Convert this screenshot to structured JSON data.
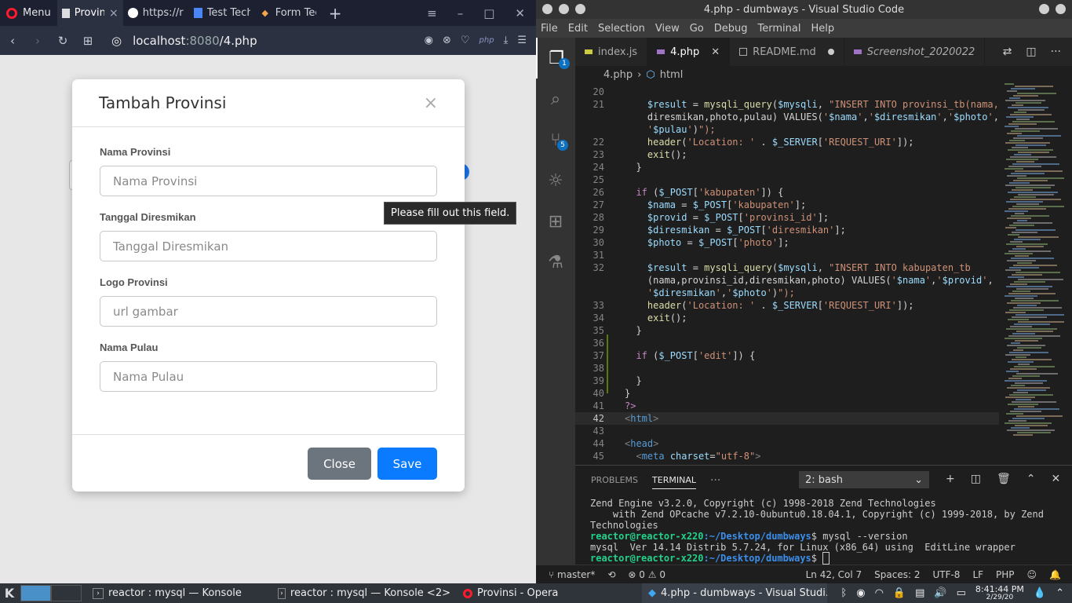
{
  "browser": {
    "menu_label": "Menu",
    "tabs": [
      {
        "label": "Provinsi",
        "active": true
      },
      {
        "label": "https://r"
      },
      {
        "label": "Test Tech"
      },
      {
        "label": "Form Tech"
      }
    ],
    "url_host": "localhost",
    "url_port": ":8080",
    "url_path": "/4.php",
    "php_badge": "php"
  },
  "modal": {
    "title": "Tambah Provinsi",
    "close_glyph": "×",
    "fields": [
      {
        "label": "Nama Provinsi",
        "placeholder": "Nama Provinsi"
      },
      {
        "label": "Tanggal Diresmikan",
        "placeholder": "Tanggal Diresmikan"
      },
      {
        "label": "Logo Provinsi",
        "placeholder": "url gambar"
      },
      {
        "label": "Nama Pulau",
        "placeholder": "Nama Pulau"
      }
    ],
    "close_button": "Close",
    "save_button": "Save",
    "tooltip": "Please fill out this field."
  },
  "vscode": {
    "title": "4.php - dumbways - Visual Studio Code",
    "menu": [
      "File",
      "Edit",
      "Selection",
      "View",
      "Go",
      "Debug",
      "Terminal",
      "Help"
    ],
    "tabs": [
      {
        "label": "index.js"
      },
      {
        "label": "4.php",
        "active": true
      },
      {
        "label": "README.md",
        "modified": true
      },
      {
        "label": "Screenshot_2020022"
      }
    ],
    "breadcrumb": [
      "4.php",
      "html"
    ],
    "badges": {
      "explorer": "1",
      "scm": "5"
    },
    "code_lines": [
      {
        "n": "20",
        "t": ""
      },
      {
        "n": "21",
        "t": "    $result = mysqli_query($mysqli, \"INSERT INTO provinsi_tb(nama,"
      },
      {
        "n": "",
        "t": "    diresmikan,photo,pulau) VALUES('$nama','$diresmikan','$photo',"
      },
      {
        "n": "",
        "t": "    '$pulau')\");"
      },
      {
        "n": "22",
        "t": "    header('Location: ' . $_SERVER['REQUEST_URI']);"
      },
      {
        "n": "23",
        "t": "    exit();"
      },
      {
        "n": "24",
        "t": "  }"
      },
      {
        "n": "25",
        "t": ""
      },
      {
        "n": "26",
        "t": "  if ($_POST['kabupaten']) {"
      },
      {
        "n": "27",
        "t": "    $nama = $_POST['kabupaten'];"
      },
      {
        "n": "28",
        "t": "    $provid = $_POST['provinsi_id'];"
      },
      {
        "n": "29",
        "t": "    $diresmikan = $_POST['diresmikan'];"
      },
      {
        "n": "30",
        "t": "    $photo = $_POST['photo'];"
      },
      {
        "n": "31",
        "t": ""
      },
      {
        "n": "32",
        "t": "    $result = mysqli_query($mysqli, \"INSERT INTO kabupaten_tb"
      },
      {
        "n": "",
        "t": "    (nama,provinsi_id,diresmikan,photo) VALUES('$nama','$provid',"
      },
      {
        "n": "",
        "t": "    '$diresmikan','$photo')\");"
      },
      {
        "n": "33",
        "t": "    header('Location: ' . $_SERVER['REQUEST_URI']);"
      },
      {
        "n": "34",
        "t": "    exit();"
      },
      {
        "n": "35",
        "t": "  }"
      },
      {
        "n": "36",
        "t": ""
      },
      {
        "n": "37",
        "t": "  if ($_POST['edit']) {"
      },
      {
        "n": "38",
        "t": ""
      },
      {
        "n": "39",
        "t": "  }"
      },
      {
        "n": "40",
        "t": "}"
      },
      {
        "n": "41",
        "t": "?>"
      },
      {
        "n": "42",
        "t": "<html>"
      },
      {
        "n": "43",
        "t": ""
      },
      {
        "n": "44",
        "t": "<head>"
      },
      {
        "n": "45",
        "t": "  <meta charset=\"utf-8\">"
      }
    ],
    "panel_tabs": [
      "PROBLEMS",
      "TERMINAL"
    ],
    "panel_more": "···",
    "terminal_select": "2: bash",
    "terminal_lines": [
      "Zend Engine v3.2.0, Copyright (c) 1998-2018 Zend Technologies",
      "    with Zend OPcache v7.2.10-0ubuntu0.18.04.1, Copyright (c) 1999-2018, by Zend",
      "Technologies"
    ],
    "prompt_user": "reactor@reactor-x220",
    "prompt_path": ":~/Desktop/dumbways",
    "command": "$ mysql --version",
    "version_line": "mysql  Ver 14.14 Distrib 5.7.24, for Linux (x86_64) using  EditLine wrapper",
    "prompt_end": "$ ",
    "status": {
      "branch": "master*",
      "errors": "0",
      "warnings": "0",
      "position": "Ln 42, Col 7",
      "spaces": "Spaces: 2",
      "encoding": "UTF-8",
      "eol": "LF",
      "language": "PHP"
    }
  },
  "taskbar": {
    "launcher": "K",
    "tasks": [
      {
        "label": "reactor : mysql — Konsole"
      },
      {
        "label": "reactor : mysql — Konsole <2>"
      },
      {
        "label": "Provinsi - Opera"
      },
      {
        "label": "4.php - dumbways - Visual Studi..."
      }
    ],
    "time": "8:41:44 PM",
    "date": "2/29/20"
  }
}
